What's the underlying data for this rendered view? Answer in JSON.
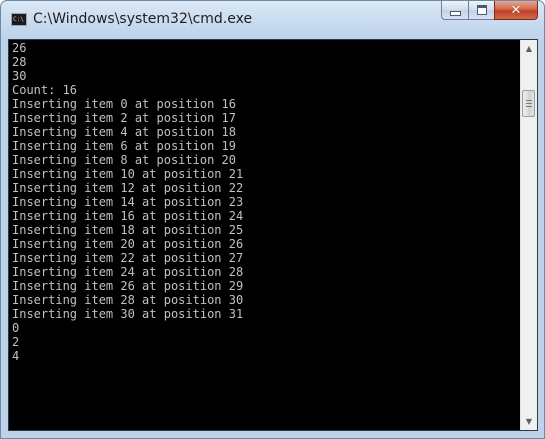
{
  "window": {
    "title": "C:\\Windows\\system32\\cmd.exe",
    "icon_text": "C:\\",
    "icon": "console-icon",
    "buttons": {
      "minimize": "minimize-icon",
      "maximize": "maximize-icon",
      "close": "close-icon"
    }
  },
  "console": {
    "text_color": "#c0c0c0",
    "background": "#000000",
    "lines": [
      "26",
      "28",
      "30",
      "Count: 16",
      "Inserting item 0 at position 16",
      "Inserting item 2 at position 17",
      "Inserting item 4 at position 18",
      "Inserting item 6 at position 19",
      "Inserting item 8 at position 20",
      "Inserting item 10 at position 21",
      "Inserting item 12 at position 22",
      "Inserting item 14 at position 23",
      "Inserting item 16 at position 24",
      "Inserting item 18 at position 25",
      "Inserting item 20 at position 26",
      "Inserting item 22 at position 27",
      "Inserting item 24 at position 28",
      "Inserting item 26 at position 29",
      "Inserting item 28 at position 30",
      "Inserting item 30 at position 31",
      "0",
      "2",
      "4"
    ]
  },
  "scrollbar": {
    "up_icon": "scroll-up-arrow-icon",
    "down_icon": "scroll-down-arrow-icon",
    "up_glyph": "▲",
    "down_glyph": "▼"
  }
}
